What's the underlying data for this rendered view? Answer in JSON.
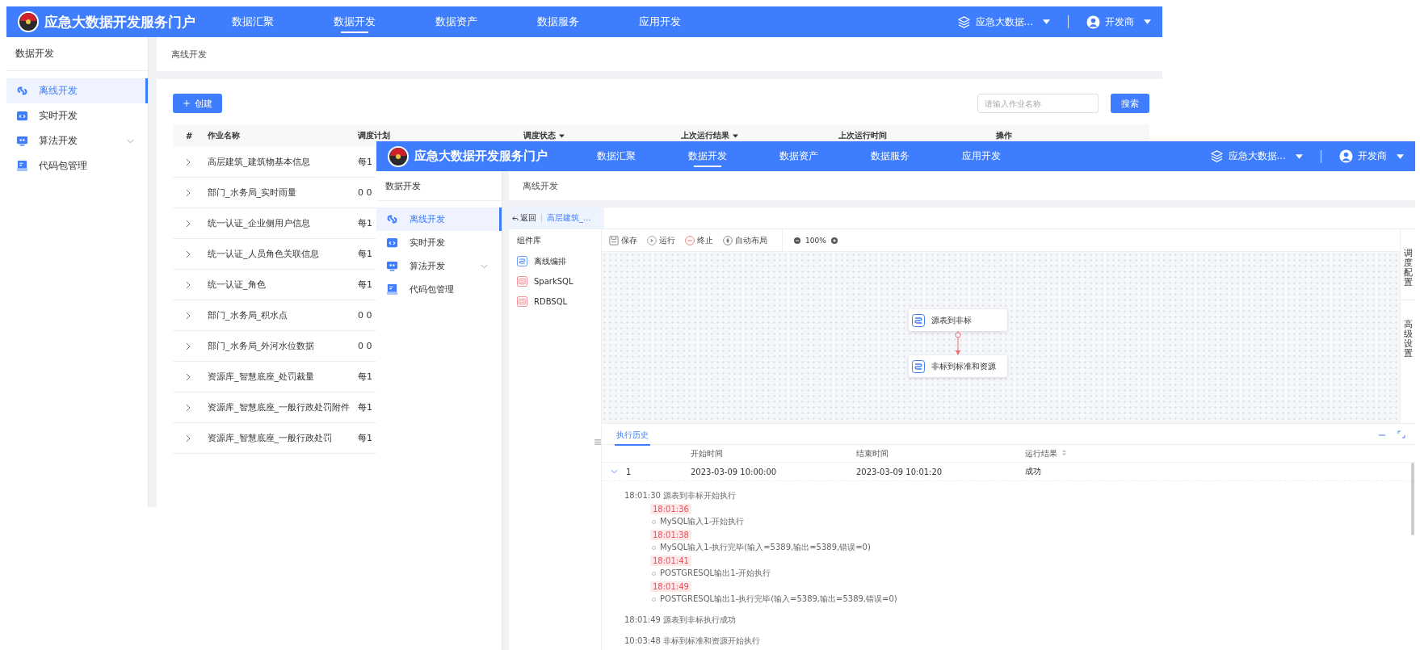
{
  "back_window": {
    "header": {
      "title": "应急大数据开发服务门户",
      "nav": [
        {
          "label": "数据汇聚",
          "selected": false
        },
        {
          "label": "数据开发",
          "selected": true
        },
        {
          "label": "数据资产",
          "selected": false
        },
        {
          "label": "数据服务",
          "selected": false
        },
        {
          "label": "应用开发",
          "selected": false
        }
      ],
      "workspace": "应急大数据...",
      "user": "开发商"
    },
    "sidebar": {
      "title": "数据开发",
      "items": [
        {
          "label": "离线开发",
          "kind": "offline",
          "selected": true,
          "has_children": false
        },
        {
          "label": "实时开发",
          "kind": "realtime",
          "selected": false,
          "has_children": false
        },
        {
          "label": "算法开发",
          "kind": "algorithm",
          "selected": false,
          "has_children": true
        },
        {
          "label": "代码包管理",
          "kind": "package",
          "selected": false,
          "has_children": false
        }
      ]
    },
    "breadcrumb": "离线开发",
    "create_button": "创建",
    "search": {
      "placeholder": "请输入作业名称",
      "button": "搜索"
    },
    "table": {
      "columns": [
        {
          "label": "#",
          "filter": false
        },
        {
          "label": "作业名称",
          "filter": false
        },
        {
          "label": "调度计划",
          "filter": false
        },
        {
          "label": "调度状态",
          "filter": true
        },
        {
          "label": "上次运行结果",
          "filter": true
        },
        {
          "label": "上次运行时间",
          "filter": false
        },
        {
          "label": "操作",
          "filter": false
        }
      ],
      "rows": [
        {
          "name": "高层建筑_建筑物基本信息",
          "schedule": "每1"
        },
        {
          "name": "部门_水务局_实时雨量",
          "schedule": "0 0"
        },
        {
          "name": "统一认证_企业侧用户信息",
          "schedule": "每1"
        },
        {
          "name": "统一认证_人员角色关联信息",
          "schedule": "每1"
        },
        {
          "name": "统一认证_角色",
          "schedule": "每1"
        },
        {
          "name": "部门_水务局_积水点",
          "schedule": "0 0"
        },
        {
          "name": "部门_水务局_外河水位数据",
          "schedule": "0 0"
        },
        {
          "name": "资源库_智慧底座_处罚裁量",
          "schedule": "每1"
        },
        {
          "name": "资源库_智慧底座_一般行政处罚附件",
          "schedule": "每1"
        },
        {
          "name": "资源库_智慧底座_一般行政处罚",
          "schedule": "每1"
        }
      ]
    }
  },
  "front_window": {
    "header": {
      "title": "应急大数据开发服务门户",
      "nav": [
        {
          "label": "数据汇聚",
          "selected": false
        },
        {
          "label": "数据开发",
          "selected": true
        },
        {
          "label": "数据资产",
          "selected": false
        },
        {
          "label": "数据服务",
          "selected": false
        },
        {
          "label": "应用开发",
          "selected": false
        }
      ],
      "workspace": "应急大数据...",
      "user": "开发商"
    },
    "sidebar": {
      "title": "数据开发",
      "items": [
        {
          "label": "离线开发",
          "kind": "offline",
          "selected": true,
          "has_children": false
        },
        {
          "label": "实时开发",
          "kind": "realtime",
          "selected": false,
          "has_children": false
        },
        {
          "label": "算法开发",
          "kind": "algorithm",
          "selected": false,
          "has_children": true
        },
        {
          "label": "代码包管理",
          "kind": "package",
          "selected": false,
          "has_children": false
        }
      ]
    },
    "breadcrumb": "离线开发",
    "editor": {
      "back": "返回",
      "job_tab": "高层建筑_...",
      "library": {
        "title": "组件库",
        "items": [
          {
            "label": "离线编排",
            "kind": "flow"
          },
          {
            "label": "SparkSQL",
            "kind": "sql"
          },
          {
            "label": "RDBSQL",
            "kind": "sql"
          }
        ]
      },
      "toolbar": [
        {
          "label": "保存",
          "kind": "save"
        },
        {
          "label": "运行",
          "kind": "run"
        },
        {
          "label": "终止",
          "kind": "stop"
        },
        {
          "label": "自动布局",
          "kind": "layout"
        }
      ],
      "zoom": "100%",
      "nodes": [
        {
          "label": "源表到非标"
        },
        {
          "label": "非标到标准和资源"
        }
      ],
      "side_tabs": [
        "调度配置",
        "高级设置"
      ]
    },
    "history": {
      "tab": "执行历史",
      "columns": [
        {
          "label": "开始时间",
          "sortable": false
        },
        {
          "label": "结束时间",
          "sortable": false
        },
        {
          "label": "运行结果",
          "sortable": true
        }
      ],
      "rows": [
        {
          "index": "1",
          "start": "2023-03-09 10:00:00",
          "end": "2023-03-09 10:01:20",
          "result": "成功",
          "expanded": true
        }
      ],
      "log": [
        {
          "kind": "step",
          "text": "18:01:30 源表到非标开始执行"
        },
        {
          "kind": "time",
          "text": "18:01:36"
        },
        {
          "kind": "event",
          "text": "MySQL输入1-开始执行"
        },
        {
          "kind": "time",
          "text": "18:01:38"
        },
        {
          "kind": "event",
          "text": "MySQL输入1-执行完毕(输入=5389,输出=5389,错误=0)"
        },
        {
          "kind": "time",
          "text": "18:01:41"
        },
        {
          "kind": "event",
          "text": "POSTGRESQL输出1-开始执行"
        },
        {
          "kind": "time",
          "text": "18:01:49"
        },
        {
          "kind": "event",
          "text": "POSTGRESQL输出1-执行完毕(输入=5389,输出=5389,错误=0)"
        },
        {
          "kind": "step",
          "text": "18:01:49 源表到非标执行成功"
        },
        {
          "kind": "step",
          "text": "10:03:48 非标到标准和资源开始执行"
        }
      ]
    }
  }
}
